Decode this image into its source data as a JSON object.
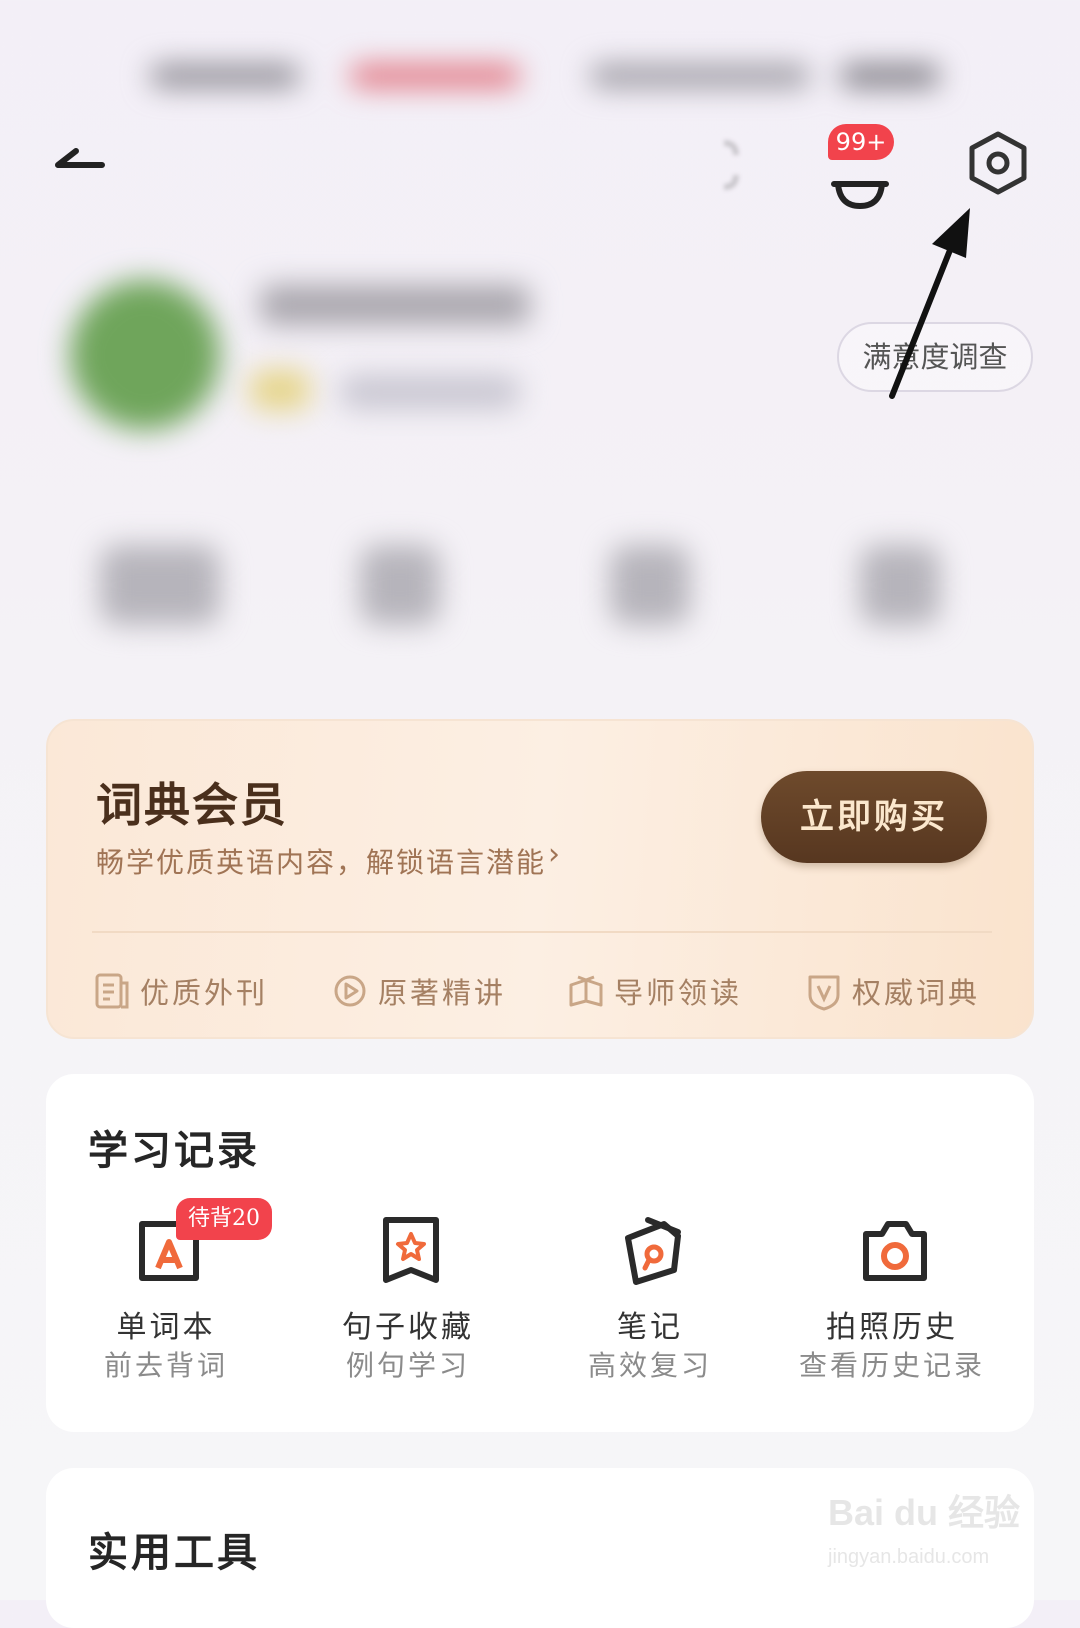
{
  "header": {
    "notification_count": "99+",
    "survey_label": "满意度调查"
  },
  "vip": {
    "title": "词典会员",
    "subtitle": "畅学优质英语内容，解锁语言潜能",
    "chevron": "›",
    "buy_label": "立即购买",
    "perks": [
      {
        "label": "优质外刊",
        "icon": "magazine-icon"
      },
      {
        "label": "原著精讲",
        "icon": "play-icon"
      },
      {
        "label": "导师领读",
        "icon": "book-icon"
      },
      {
        "label": "权威词典",
        "icon": "shield-v-icon"
      }
    ]
  },
  "study": {
    "title": "学习记录",
    "items": [
      {
        "label": "单词本",
        "sub": "前去背词",
        "icon": "wordbook-icon",
        "badge": "待背20"
      },
      {
        "label": "句子收藏",
        "sub": "例句学习",
        "icon": "sentence-bookmark-icon"
      },
      {
        "label": "笔记",
        "sub": "高效复习",
        "icon": "note-icon"
      },
      {
        "label": "拍照历史",
        "sub": "查看历史记录",
        "icon": "camera-icon"
      }
    ]
  },
  "tools": {
    "title": "实用工具"
  },
  "watermark": {
    "text": "Bai du 经验",
    "sub": "jingyan.baidu.com"
  },
  "colors": {
    "badge_red": "#f2434c",
    "accent_orange": "#f06a3b",
    "buy_brown": "#5f3e24",
    "vip_gold": "#a58063"
  }
}
